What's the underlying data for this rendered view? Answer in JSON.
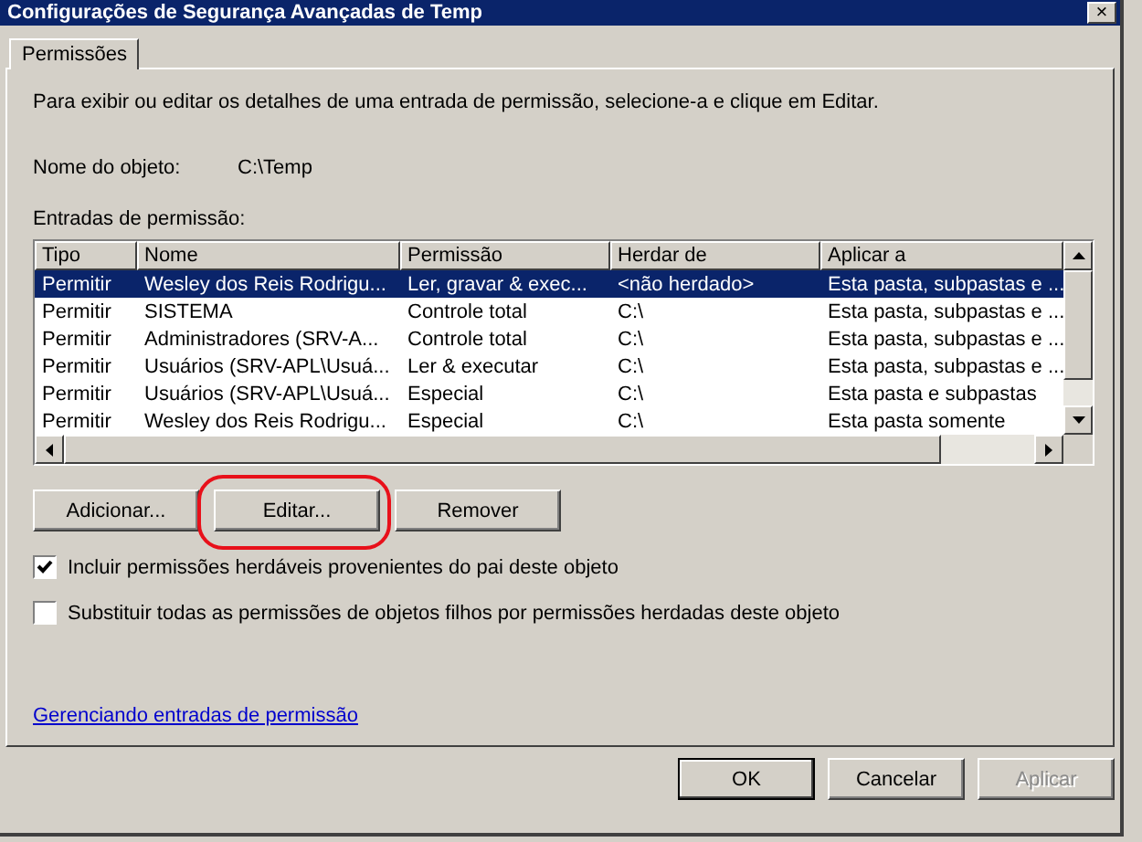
{
  "window": {
    "title": "Configurações de Segurança Avançadas de Temp",
    "close": "×"
  },
  "tabs": [
    {
      "label": "Permissões",
      "selected": true
    }
  ],
  "intro": "Para exibir ou editar os detalhes de uma entrada de permissão, selecione-a e clique em Editar.",
  "object_name": {
    "label": "Nome do objeto:",
    "value": "C:\\Temp"
  },
  "entries_label": "Entradas de permissão:",
  "table": {
    "columns": [
      "Tipo",
      "Nome",
      "Permissão",
      "Herdar de",
      "Aplicar a"
    ],
    "rows": [
      {
        "cells": [
          "Permitir",
          "Wesley dos Reis Rodrigu...",
          "Ler, gravar & exec...",
          "<não herdado>",
          "Esta pasta, subpastas e ..."
        ],
        "selected": true
      },
      {
        "cells": [
          "Permitir",
          "SISTEMA",
          "Controle total",
          "C:\\",
          "Esta pasta, subpastas e ..."
        ],
        "selected": false
      },
      {
        "cells": [
          "Permitir",
          "Administradores (SRV-A...",
          "Controle total",
          "C:\\",
          "Esta pasta, subpastas e ..."
        ],
        "selected": false
      },
      {
        "cells": [
          "Permitir",
          "Usuários (SRV-APL\\Usuá...",
          "Ler & executar",
          "C:\\",
          "Esta pasta, subpastas e ..."
        ],
        "selected": false
      },
      {
        "cells": [
          "Permitir",
          "Usuários (SRV-APL\\Usuá...",
          "Especial",
          "C:\\",
          "Esta pasta e subpastas"
        ],
        "selected": false
      },
      {
        "cells": [
          "Permitir",
          "Wesley dos Reis Rodrigu...",
          "Especial",
          "C:\\",
          "Esta pasta somente"
        ],
        "selected": false
      }
    ]
  },
  "entry_buttons": [
    {
      "label": "Adicionar...",
      "highlighted": false
    },
    {
      "label": "Editar...",
      "highlighted": true
    },
    {
      "label": "Remover",
      "highlighted": false
    }
  ],
  "checkboxes": [
    {
      "label": "Incluir permissões herdáveis provenientes do pai deste objeto",
      "checked": true
    },
    {
      "label": "Substituir todas as permissões de objetos filhos por permissões herdadas deste objeto",
      "checked": false
    }
  ],
  "link": "Gerenciando entradas de permissão",
  "dialog_buttons": [
    {
      "label": "OK",
      "default": true,
      "disabled": false
    },
    {
      "label": "Cancelar",
      "default": false,
      "disabled": false
    },
    {
      "label": "Aplicar",
      "default": false,
      "disabled": true
    }
  ]
}
